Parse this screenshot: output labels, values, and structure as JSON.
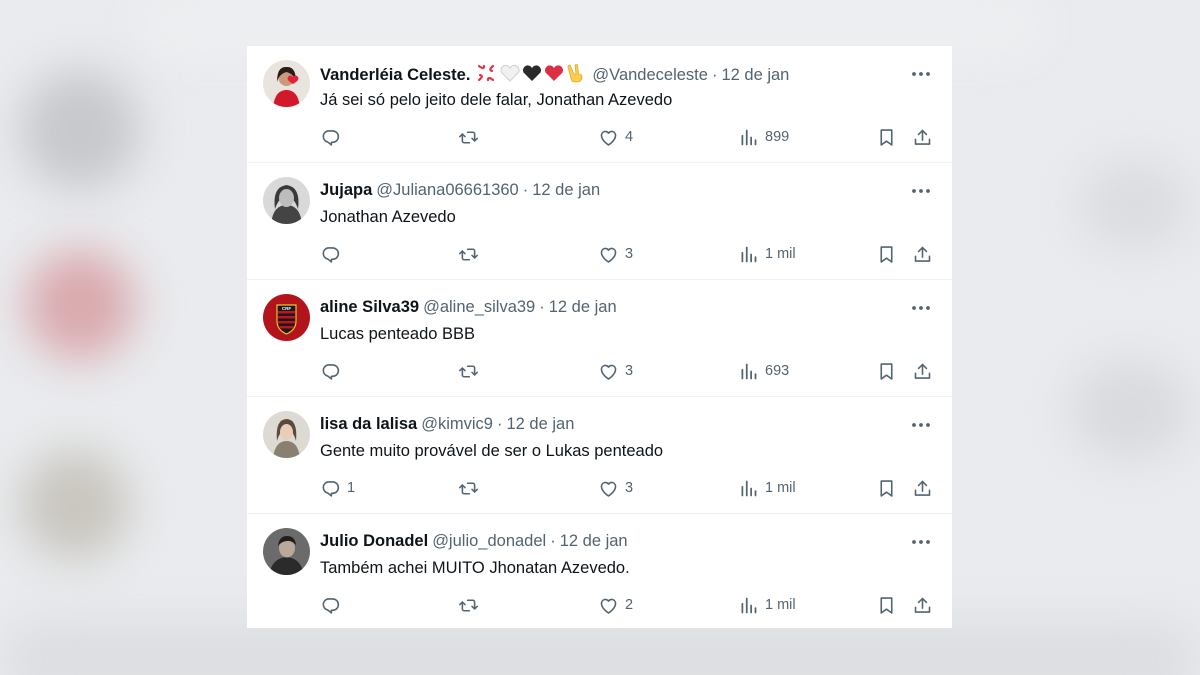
{
  "tweets": [
    {
      "name": "Vanderléia Celeste.",
      "name_emojis": [
        "anger-emoji",
        "white-heart-emoji",
        "black-heart-emoji",
        "red-heart-emoji",
        "victory-hand-emoji"
      ],
      "handle": "@Vandeceleste",
      "date": "12 de jan",
      "text": "Já sei só pelo jeito dele falar, Jonathan Azevedo",
      "replies": "",
      "likes": "4",
      "views": "899",
      "avatar": "avatar-woman-red-dress"
    },
    {
      "name": "Jujapa",
      "handle": "@Juliana06661360",
      "date": "12 de jan",
      "text": "Jonathan Azevedo",
      "replies": "",
      "likes": "3",
      "views": "1 mil",
      "avatar": "avatar-woman-grayscale"
    },
    {
      "name": "aline Silva39",
      "handle": "@aline_silva39",
      "date": "12 de jan",
      "text": "Lucas penteado BBB",
      "replies": "",
      "likes": "3",
      "views": "693",
      "avatar": "avatar-flamengo-crest"
    },
    {
      "name": "lisa da lalisa",
      "handle": "@kimvic9",
      "date": "12 de jan",
      "text": "Gente muito provável de ser o Lukas penteado",
      "replies": "1",
      "likes": "3",
      "views": "1 mil",
      "avatar": "avatar-person-light"
    },
    {
      "name": "Julio Donadel",
      "handle": "@julio_donadel",
      "date": "12 de jan",
      "text": "Também achei MUITO Jhonatan Azevedo.",
      "replies": "",
      "likes": "2",
      "views": "1 mil",
      "avatar": "avatar-man-dark"
    }
  ],
  "separator": "·",
  "colors": {
    "text_primary": "#0f1419",
    "text_secondary": "#536471",
    "divider": "#eff3f4",
    "background": "#ffffff"
  }
}
